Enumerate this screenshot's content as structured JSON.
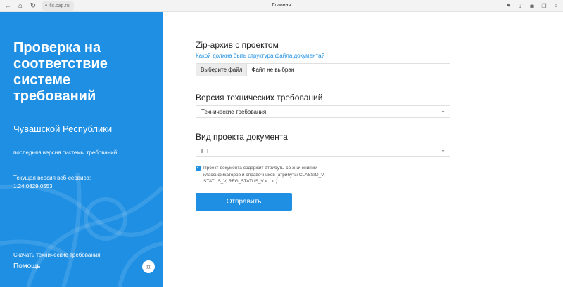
{
  "browser": {
    "url": "fic.cap.ru",
    "tab_title": "Главная"
  },
  "sidebar": {
    "title": "Проверка на соответствие системе требований",
    "subtitle": "Чувашской Республики",
    "last_version_label": "последняя версия системы требований:",
    "current_version_line1": "Текущая версия веб-сервиса:",
    "current_version_line2": "1.24.0829.0553",
    "download_link": "Скачать технические требования",
    "help_link": "Помощь"
  },
  "form": {
    "zip_label": "Zip-архив с проектом",
    "structure_link": "Какой должна быть структура файла документа?",
    "file_button": "Выберите файл",
    "file_status": "Файл не выбран",
    "version_label": "Версия технических требований",
    "version_value": "Технические требования",
    "doc_type_label": "Вид проекта документа",
    "doc_type_value": "ГП",
    "checkbox_checked": true,
    "checkbox_text": "Проект документа содержит атрибуты со значениями классификаторов и справочников (атрибуты CLASSID_V, STATUS_V, REG_STATUS_V и т.д.)",
    "submit_label": "Отправить"
  },
  "colors": {
    "accent": "#1e8fe3"
  }
}
